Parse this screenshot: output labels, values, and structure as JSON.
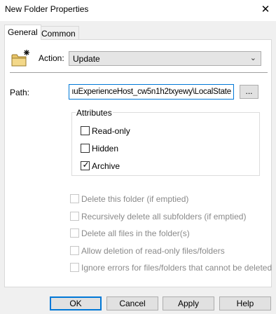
{
  "window": {
    "title": "New Folder Properties",
    "close_glyph": "✕"
  },
  "tabs": [
    {
      "label": "General",
      "active": true
    },
    {
      "label": "Common",
      "active": false
    }
  ],
  "general": {
    "action_label": "Action:",
    "action_value": "Update",
    "path_label": "Path:",
    "path_value": "ıuExperienceHost_cw5n1h2txyewy\\LocalState",
    "browse_label": "...",
    "attributes_title": "Attributes",
    "attributes": [
      {
        "label": "Read-only",
        "checked": false
      },
      {
        "label": "Hidden",
        "checked": false
      },
      {
        "label": "Archive",
        "checked": true
      }
    ],
    "options": [
      {
        "label": "Delete this folder (if emptied)",
        "checked": false
      },
      {
        "label": "Recursively delete all subfolders (if emptied)",
        "checked": false
      },
      {
        "label": "Delete all files in the folder(s)",
        "checked": false
      },
      {
        "label": "Allow deletion of read-only files/folders",
        "checked": false
      },
      {
        "label": "Ignore errors for files/folders that cannot be deleted",
        "checked": false
      }
    ]
  },
  "buttons": {
    "ok": "OK",
    "cancel": "Cancel",
    "apply": "Apply",
    "help": "Help"
  },
  "icons": {
    "folder": "folder-star-icon",
    "chevron": "chevron-down-icon",
    "check": "checkmark-icon"
  },
  "colors": {
    "focus": "#0078d7",
    "window": "#f0f0f0"
  }
}
